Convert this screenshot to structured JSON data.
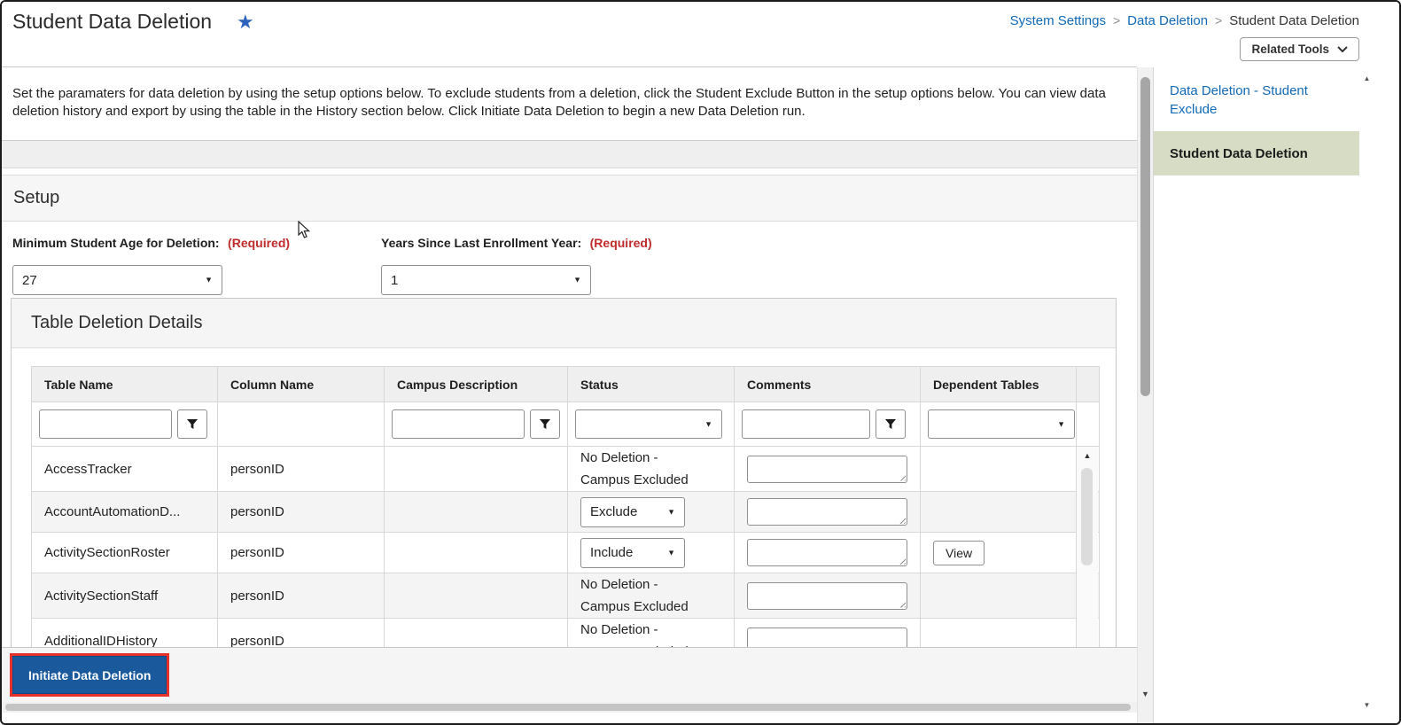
{
  "header": {
    "page_title": "Student Data Deletion",
    "breadcrumb": {
      "items": [
        "System Settings",
        "Data Deletion",
        "Student Data Deletion"
      ],
      "separator": ">"
    },
    "related_tools": {
      "label": "Related Tools"
    }
  },
  "main": {
    "description": "Set the paramaters for data deletion by using the setup options below. To exclude students from a deletion, click the Student Exclude Button in the setup options below. You can view data deletion history and export by using the table in the History section below. Click Initiate Data Deletion to begin a new Data Deletion run.",
    "setup": {
      "title": "Setup",
      "fields": [
        {
          "label": "Minimum Student Age for Deletion:",
          "required_tag": "(Required)",
          "value": "27"
        },
        {
          "label": "Years Since Last Enrollment Year:",
          "required_tag": "(Required)",
          "value": "1"
        }
      ]
    },
    "table_details": {
      "title": "Table Deletion Details",
      "columns": [
        "Table Name",
        "Column Name",
        "Campus Description",
        "Status",
        "Comments",
        "Dependent Tables"
      ],
      "filters": {
        "table_name_value": "",
        "campus_description_value": "",
        "status_value": "",
        "comments_value": "",
        "dependent_tables_value": ""
      },
      "rows": [
        {
          "table_name": "AccessTracker",
          "column_name": "personID",
          "campus_description": "",
          "status": "No Deletion - Campus Excluded",
          "comment": "",
          "dependent_tables": ""
        },
        {
          "table_name": "AccountAutomationD...",
          "column_name": "personID",
          "campus_description": "",
          "status": "Exclude",
          "comment": "",
          "dependent_tables": ""
        },
        {
          "table_name": "ActivitySectionRoster",
          "column_name": "personID",
          "campus_description": "",
          "status": "Include",
          "comment": "",
          "dependent_tables": "View"
        },
        {
          "table_name": "ActivitySectionStaff",
          "column_name": "personID",
          "campus_description": "",
          "status": "No Deletion - Campus Excluded",
          "comment": "",
          "dependent_tables": ""
        },
        {
          "table_name": "AdditionalIDHistory",
          "column_name": "personID",
          "campus_description": "",
          "status": "No Deletion - Campus Excluded",
          "comment": "",
          "dependent_tables": ""
        }
      ]
    },
    "footer": {
      "initiate_button_label": "Initiate Data Deletion"
    }
  },
  "sidebar": {
    "items": [
      {
        "label": "Data Deletion - Student Exclude",
        "selected": false
      },
      {
        "label": "Student Data Deletion",
        "selected": true
      }
    ]
  },
  "icons": {
    "favorite_star": "★",
    "caret_down": "▼",
    "arrow_up": "▲",
    "arrow_down": "▼"
  },
  "colors": {
    "link_blue": "#1269b5",
    "button_blue": "#19599c",
    "highlight_red": "#e8312a",
    "required_red": "#c02b2b",
    "selected_green": "#d7ddc5"
  }
}
